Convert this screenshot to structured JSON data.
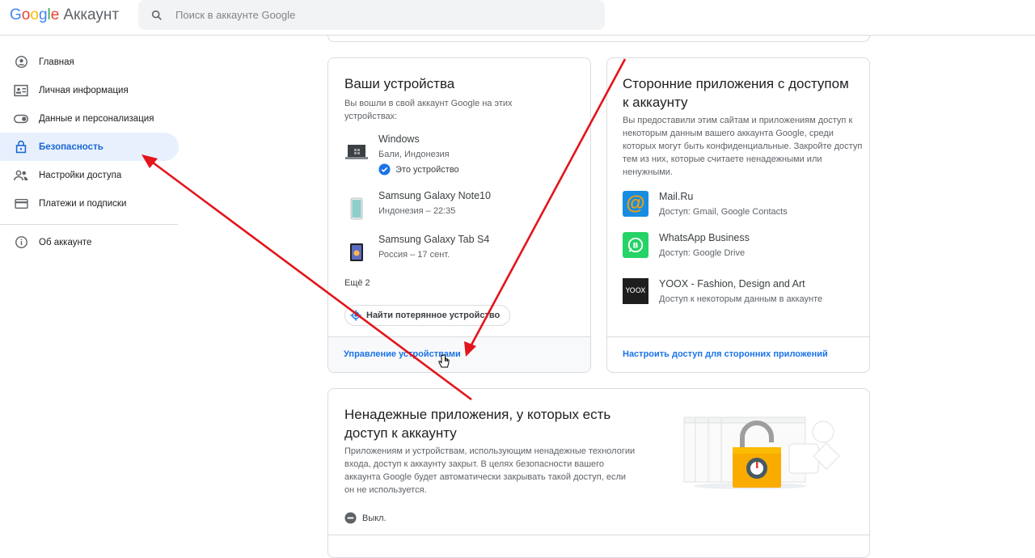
{
  "header": {
    "logo_google": [
      "G",
      "o",
      "o",
      "g",
      "l",
      "e"
    ],
    "logo_product": "Аккаунт",
    "search_placeholder": "Поиск в аккаунте Google"
  },
  "sidebar": {
    "items": [
      {
        "label": "Главная",
        "icon": "home-icon"
      },
      {
        "label": "Личная информация",
        "icon": "id-card-icon"
      },
      {
        "label": "Данные и персонализация",
        "icon": "toggle-icon"
      },
      {
        "label": "Безопасность",
        "icon": "lock-icon",
        "active": true
      },
      {
        "label": "Настройки доступа",
        "icon": "people-icon"
      },
      {
        "label": "Платежи и подписки",
        "icon": "credit-card-icon"
      }
    ],
    "about": {
      "label": "Об аккаунте",
      "icon": "info-icon"
    }
  },
  "devices_card": {
    "title": "Ваши устройства",
    "description": "Вы вошли в свой аккаунт Google на этих устройствах:",
    "devices": [
      {
        "name": "Windows",
        "location": "Бали, Индонезия",
        "this_device": "Это устройство"
      },
      {
        "name": "Samsung Galaxy Note10",
        "location": "Индонезия – 22:35"
      },
      {
        "name": "Samsung Galaxy Tab S4",
        "location": "Россия – 17 сент."
      }
    ],
    "more": "Ещё 2",
    "find_button": "Найти потерянное устройство",
    "manage_link": "Управление устройствами"
  },
  "apps_card": {
    "title": "Сторонние приложения с доступом к аккаунту",
    "description": "Вы предоставили этим сайтам и приложениям доступ к некоторым данным вашего аккаунта Google, среди которых могут быть конфиденциальные. Закройте доступ тем из них, которые считаете ненадежными или ненужными.",
    "apps": [
      {
        "name": "Mail.Ru",
        "access": "Доступ: Gmail, Google Contacts",
        "icon": "mailru-icon"
      },
      {
        "name": "WhatsApp Business",
        "access": "Доступ: Google Drive",
        "icon": "whatsapp-icon"
      },
      {
        "name": "YOOX - Fashion, Design and Art",
        "access": "Доступ к некоторым данным в аккаунте",
        "icon": "yoox-icon",
        "icon_text": "YOOX"
      }
    ],
    "manage_link": "Настроить доступ для сторонних приложений"
  },
  "insecure_card": {
    "title": "Ненадежные приложения, у которых есть доступ к аккаунту",
    "description": "Приложениям и устройствам, использующим ненадежные технологии входа, доступ к аккаунту закрыт. В целях безопасности вашего аккаунта Google будет автоматически закрывать такой доступ, если он не используется.",
    "status": "Выкл."
  },
  "colors": {
    "accent": "#1a73e8",
    "active_bg": "#e8f0fe",
    "annotation_arrow": "#e3141b"
  }
}
